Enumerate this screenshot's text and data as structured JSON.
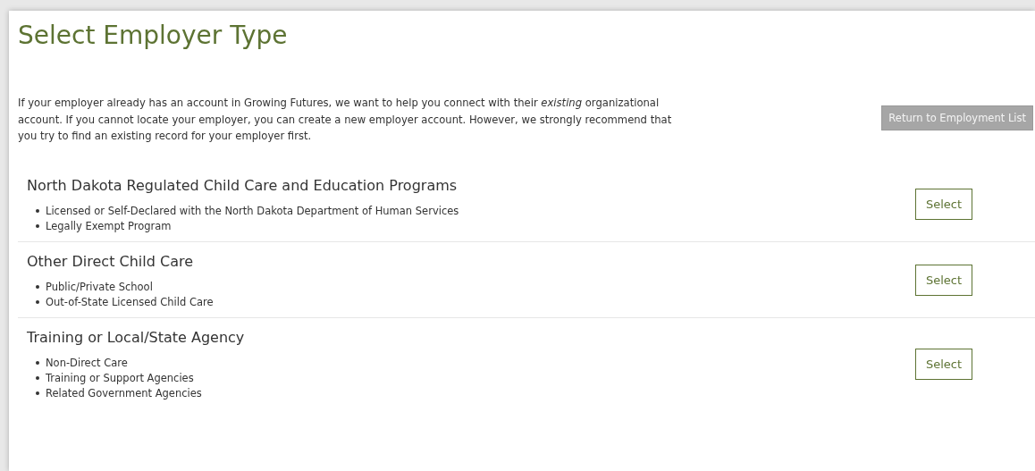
{
  "title": "Select Employer Type",
  "intro": "If your employer already has an account in Growing Futures, we want to help you connect with their *existing* organizational account. If you cannot locate your employer, you can create a new employer account. However, we strongly recommend that you try to find an existing record for your employer first.",
  "return_button": "Return to Employment List",
  "sections": [
    {
      "heading": "North Dakota Regulated Child Care and Education Programs",
      "items": [
        "Licensed or Self-Declared with the North Dakota Department of Human Services",
        "Legally Exempt Program"
      ],
      "button": "Select"
    },
    {
      "heading": "Other Direct Child Care",
      "items": [
        "Public/Private School",
        "Out-of-State Licensed Child Care"
      ],
      "button": "Select"
    },
    {
      "heading": "Training or Local/State Agency",
      "items": [
        "Non-Direct Care",
        "Training or Support Agencies",
        "Related Government Agencies"
      ],
      "button": "Select"
    }
  ]
}
